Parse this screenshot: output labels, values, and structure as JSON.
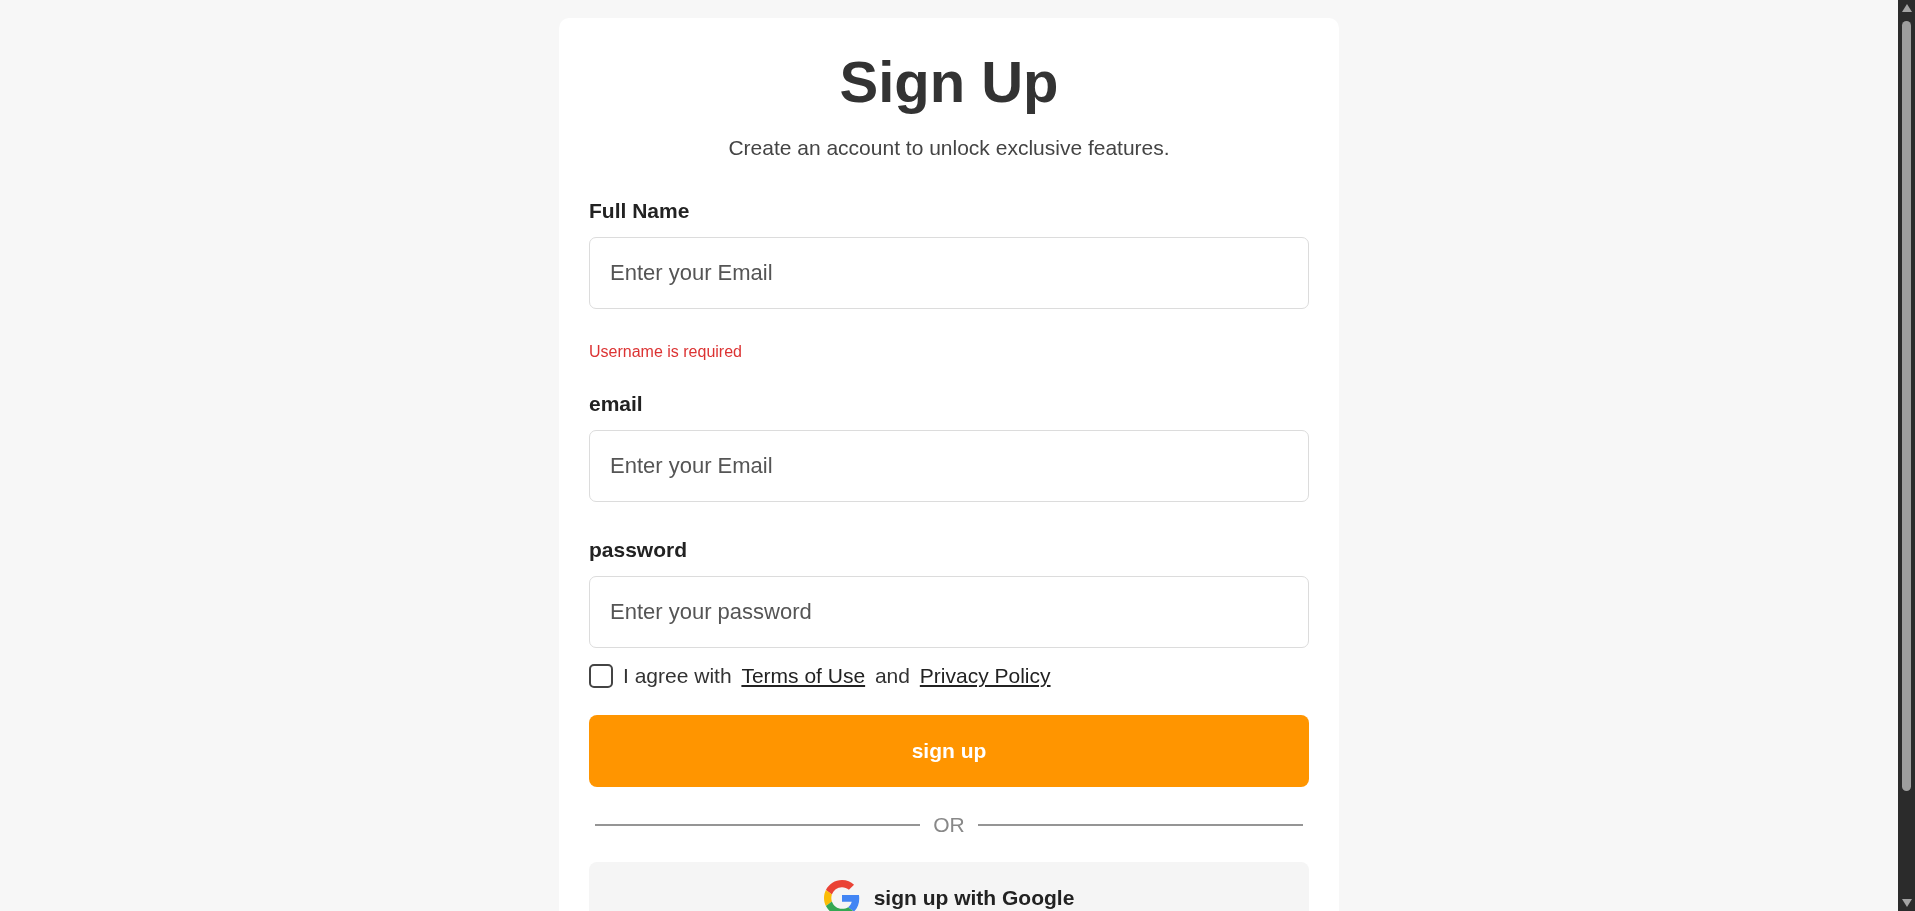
{
  "header": {
    "title": "Sign Up",
    "subtitle": "Create an account to unlock exclusive features."
  },
  "fields": [
    {
      "label": "Full Name",
      "placeholder": "Enter your Email",
      "error": "Username is required"
    },
    {
      "label": "email",
      "placeholder": "Enter your Email"
    },
    {
      "label": "password",
      "placeholder": "Enter your password"
    }
  ],
  "agreement": {
    "checked": false,
    "text_before": "I agree with",
    "terms_link": "Terms of Use",
    "conjunction": "and",
    "privacy_link": "Privacy Policy"
  },
  "submit_button": "sign up",
  "divider": "OR",
  "google_button": "sign up with Google"
}
